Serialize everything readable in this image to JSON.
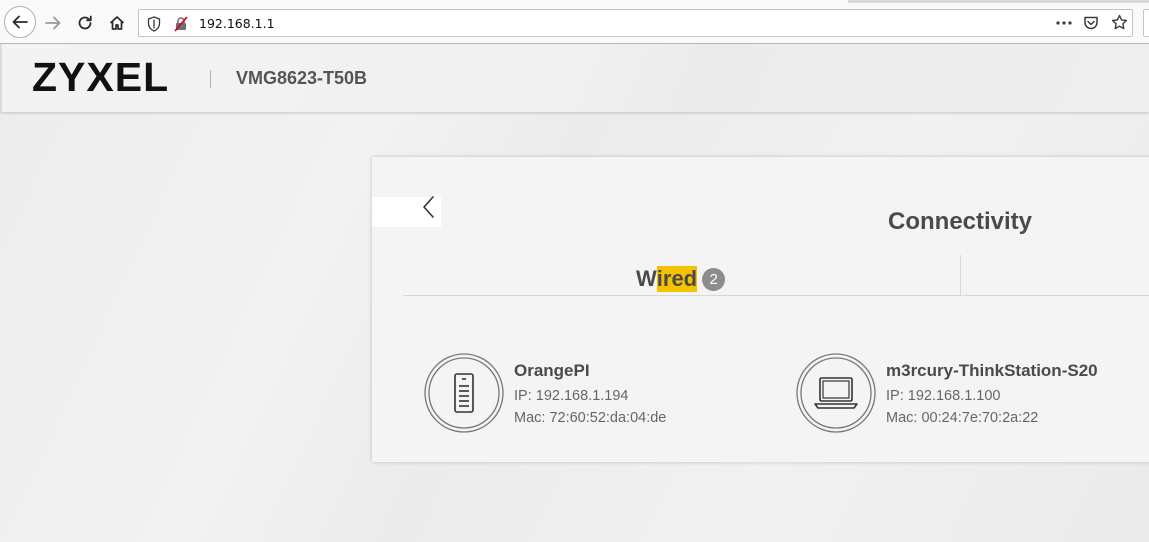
{
  "browser": {
    "url": "192.168.1.1"
  },
  "header": {
    "brand": "ZYXEL",
    "model": "VMG8623-T50B"
  },
  "card": {
    "title": "Connectivity",
    "tabs": [
      {
        "label_first": "W",
        "label_rest": "ired",
        "count": "2"
      }
    ],
    "devices": [
      {
        "name": "OrangePI",
        "ip": "IP: 192.168.1.194",
        "mac": "Mac: 72:60:52:da:04:de",
        "icon": "server-icon"
      },
      {
        "name": "m3rcury-ThinkStation-S20",
        "ip": "IP: 192.168.1.100",
        "mac": "Mac: 00:24:7e:70:2a:22",
        "icon": "laptop-icon"
      }
    ]
  },
  "colors": {
    "highlight": "#f6c200",
    "badge": "#8c8c8c"
  }
}
